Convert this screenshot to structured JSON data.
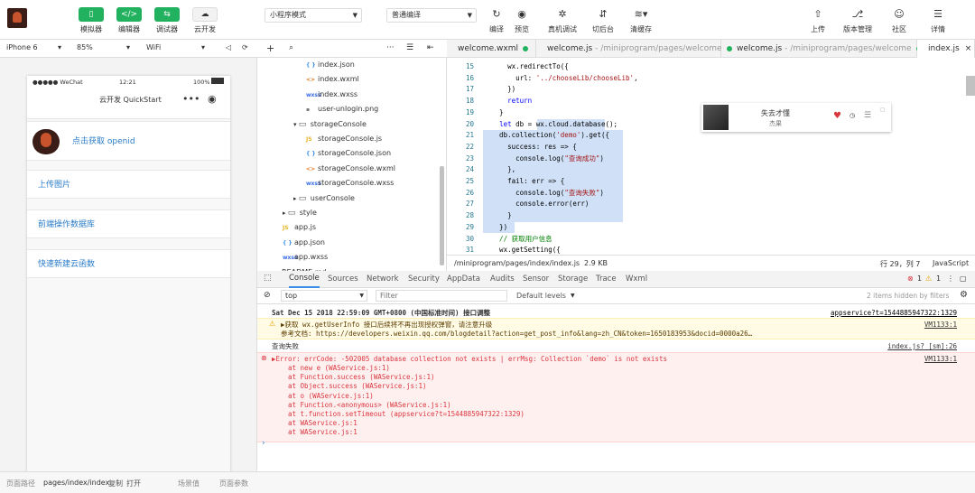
{
  "toolbar": {
    "left_buttons": [
      {
        "icon": "phone-icon",
        "label": "模拟器"
      },
      {
        "icon": "code-icon",
        "label": "编辑器"
      },
      {
        "icon": "debug-icon",
        "label": "调试器"
      },
      {
        "icon": "cloud-icon",
        "label": "云开发"
      }
    ],
    "mode_select": "小程序模式",
    "compile_select": "普通编译",
    "mid_buttons": [
      {
        "icon": "refresh-icon",
        "label": "编译"
      },
      {
        "icon": "eye-icon",
        "label": "预览"
      },
      {
        "icon": "bug-icon",
        "label": "真机调试"
      },
      {
        "icon": "switch-icon",
        "label": "切后台"
      },
      {
        "icon": "layers-icon",
        "label": "清缓存"
      }
    ],
    "right_buttons": [
      {
        "icon": "upload-icon",
        "label": "上传"
      },
      {
        "icon": "version-icon",
        "label": "版本管理"
      },
      {
        "icon": "community-icon",
        "label": "社区"
      },
      {
        "icon": "menu-icon",
        "label": "详情"
      }
    ]
  },
  "simulator": {
    "device": "iPhone 6",
    "zoom": "85%",
    "network": "WiFi",
    "status_left": "●●●●● WeChat",
    "status_time": "12:21",
    "status_battery": "100%",
    "nav_title": "云开发 QuickStart",
    "rows": [
      "点击获取 openid",
      "上传图片",
      "前端操作数据库",
      "快速新建云函数"
    ]
  },
  "tree": [
    {
      "label": "index.json",
      "type": "json",
      "depth": 3
    },
    {
      "label": "index.wxml",
      "type": "xml",
      "depth": 3
    },
    {
      "label": "index.wxss",
      "type": "css",
      "depth": 3
    },
    {
      "label": "user-unlogin.png",
      "type": "img",
      "depth": 3
    },
    {
      "label": "storageConsole",
      "type": "folder-open",
      "depth": 2
    },
    {
      "label": "storageConsole.js",
      "type": "js",
      "depth": 3
    },
    {
      "label": "storageConsole.json",
      "type": "json",
      "depth": 3
    },
    {
      "label": "storageConsole.wxml",
      "type": "xml",
      "depth": 3
    },
    {
      "label": "storageConsole.wxss",
      "type": "css",
      "depth": 3
    },
    {
      "label": "userConsole",
      "type": "folder",
      "depth": 2
    },
    {
      "label": "style",
      "type": "folder",
      "depth": 1
    },
    {
      "label": "app.js",
      "type": "js",
      "depth": 1
    },
    {
      "label": "app.json",
      "type": "json",
      "depth": 1
    },
    {
      "label": "app.wxss",
      "type": "css",
      "depth": 1
    },
    {
      "label": "README.md",
      "type": "md",
      "depth": 0
    }
  ],
  "editor_tabs": [
    {
      "name": "welcome.wxml",
      "path": ""
    },
    {
      "name": "welcome.js",
      "path": " - /miniprogram/pages/welcome"
    },
    {
      "name": "welcome.js",
      "path": " - /miniprogram/pages/welcome"
    },
    {
      "name": "index.js",
      "path": ""
    }
  ],
  "code_lines": [
    {
      "n": "15",
      "t": "      wx.redirectTo({"
    },
    {
      "n": "16",
      "t": "        url: '../chooseLib/chooseLib',"
    },
    {
      "n": "17",
      "t": "      })"
    },
    {
      "n": "18",
      "t": "      return"
    },
    {
      "n": "19",
      "t": "    }"
    },
    {
      "n": "20",
      "t": "    let db = wx.cloud.database();"
    },
    {
      "n": "21",
      "t": "    db.collection('demo').get({"
    },
    {
      "n": "22",
      "t": "      success: res => {"
    },
    {
      "n": "23",
      "t": "        console.log(\"查询成功\")"
    },
    {
      "n": "24",
      "t": "      },"
    },
    {
      "n": "25",
      "t": "      fail: err => {"
    },
    {
      "n": "26",
      "t": "        console.log(\"查询失败\")"
    },
    {
      "n": "27",
      "t": "        console.error(err)"
    },
    {
      "n": "28",
      "t": "      }"
    },
    {
      "n": "29",
      "t": "    })"
    },
    {
      "n": "30",
      "t": "    // 获取用户信息"
    },
    {
      "n": "31",
      "t": "    wx.getSetting({"
    }
  ],
  "status": {
    "path": "/miniprogram/pages/index/index.js",
    "size": "2.9 KB",
    "position": "行 29，列 7",
    "language": "JavaScript"
  },
  "music": {
    "title": "失去才懂",
    "artist": "杰果"
  },
  "console_tabs": [
    "Console",
    "Sources",
    "Network",
    "Security",
    "AppData",
    "Audits",
    "Sensor",
    "Storage",
    "Trace",
    "Wxml"
  ],
  "console_counts": {
    "errors": "1",
    "warnings": "1"
  },
  "console_filter": {
    "context": "top",
    "placeholder": "Filter",
    "levels": "Default levels",
    "hidden": "2 items hidden by filters"
  },
  "console_log": {
    "header": "Sat Dec 15 2018 22:59:09 GMT+0800 (中国标准时间) 接口调整",
    "header_ref": "appservice?t=1544885947322:1329",
    "warn1": "▶获取 wx.getUserInfo 接口后续将不再出现授权弹窗，请注意升级",
    "warn2": "参考文档: https://developers.weixin.qq.com/blogdetail?action=get_post_info&lang=zh_CN&token=1650183953&docid=0000a26…",
    "warn_ref": "VM1133:1",
    "info": "查询失败",
    "info_ref": "index.js? [sm]:26",
    "error": "▶Error: errCode: -502005 database collection not exists | errMsg: Collection `demo` is not exists",
    "error_ref": "VM1133:1",
    "stack": [
      "at new e (WAService.js:1)",
      "at Function.success (WAService.js:1)",
      "at Object.success (WAService.js:1)",
      "at o (WAService.js:1)",
      "at Function.<anonymous> (WAService.js:1)",
      "at t.function.setTimeout (appservice?t=1544885947322:1329)",
      "at WAService.js:1",
      "at WAService.js:1"
    ]
  },
  "bottom": {
    "label": "页面路径",
    "path": "pages/index/index",
    "copy": "复制",
    "open": "打开",
    "scene": "场景值",
    "params": "页面参数"
  }
}
